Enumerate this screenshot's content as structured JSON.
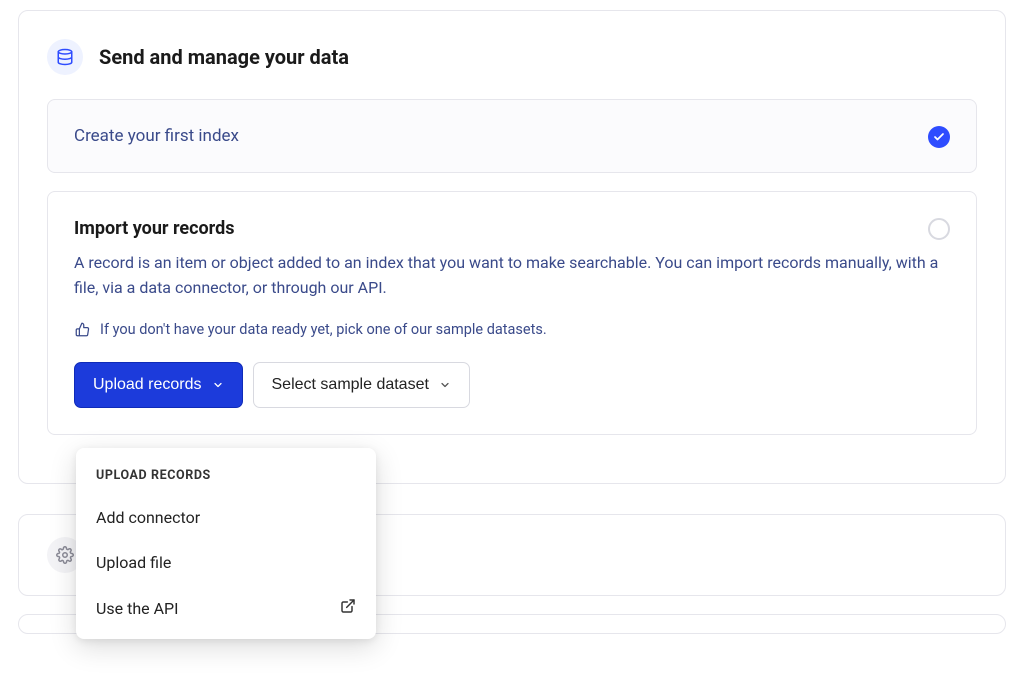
{
  "section": {
    "title": "Send and manage your data"
  },
  "step1": {
    "title": "Create your first index"
  },
  "step2": {
    "title": "Import your records",
    "description": "A record is an item or object added to an index that you want to make searchable. You can import records manually, with a file, via a data connector, or through our API.",
    "tip": "If you don't have your data ready yet, pick one of our sample datasets."
  },
  "buttons": {
    "primary": "Upload records",
    "secondary": "Select sample dataset"
  },
  "dropdown": {
    "header": "UPLOAD RECORDS",
    "items": [
      {
        "label": "Add connector"
      },
      {
        "label": "Upload file"
      },
      {
        "label": "Use the API",
        "external": true
      }
    ]
  }
}
